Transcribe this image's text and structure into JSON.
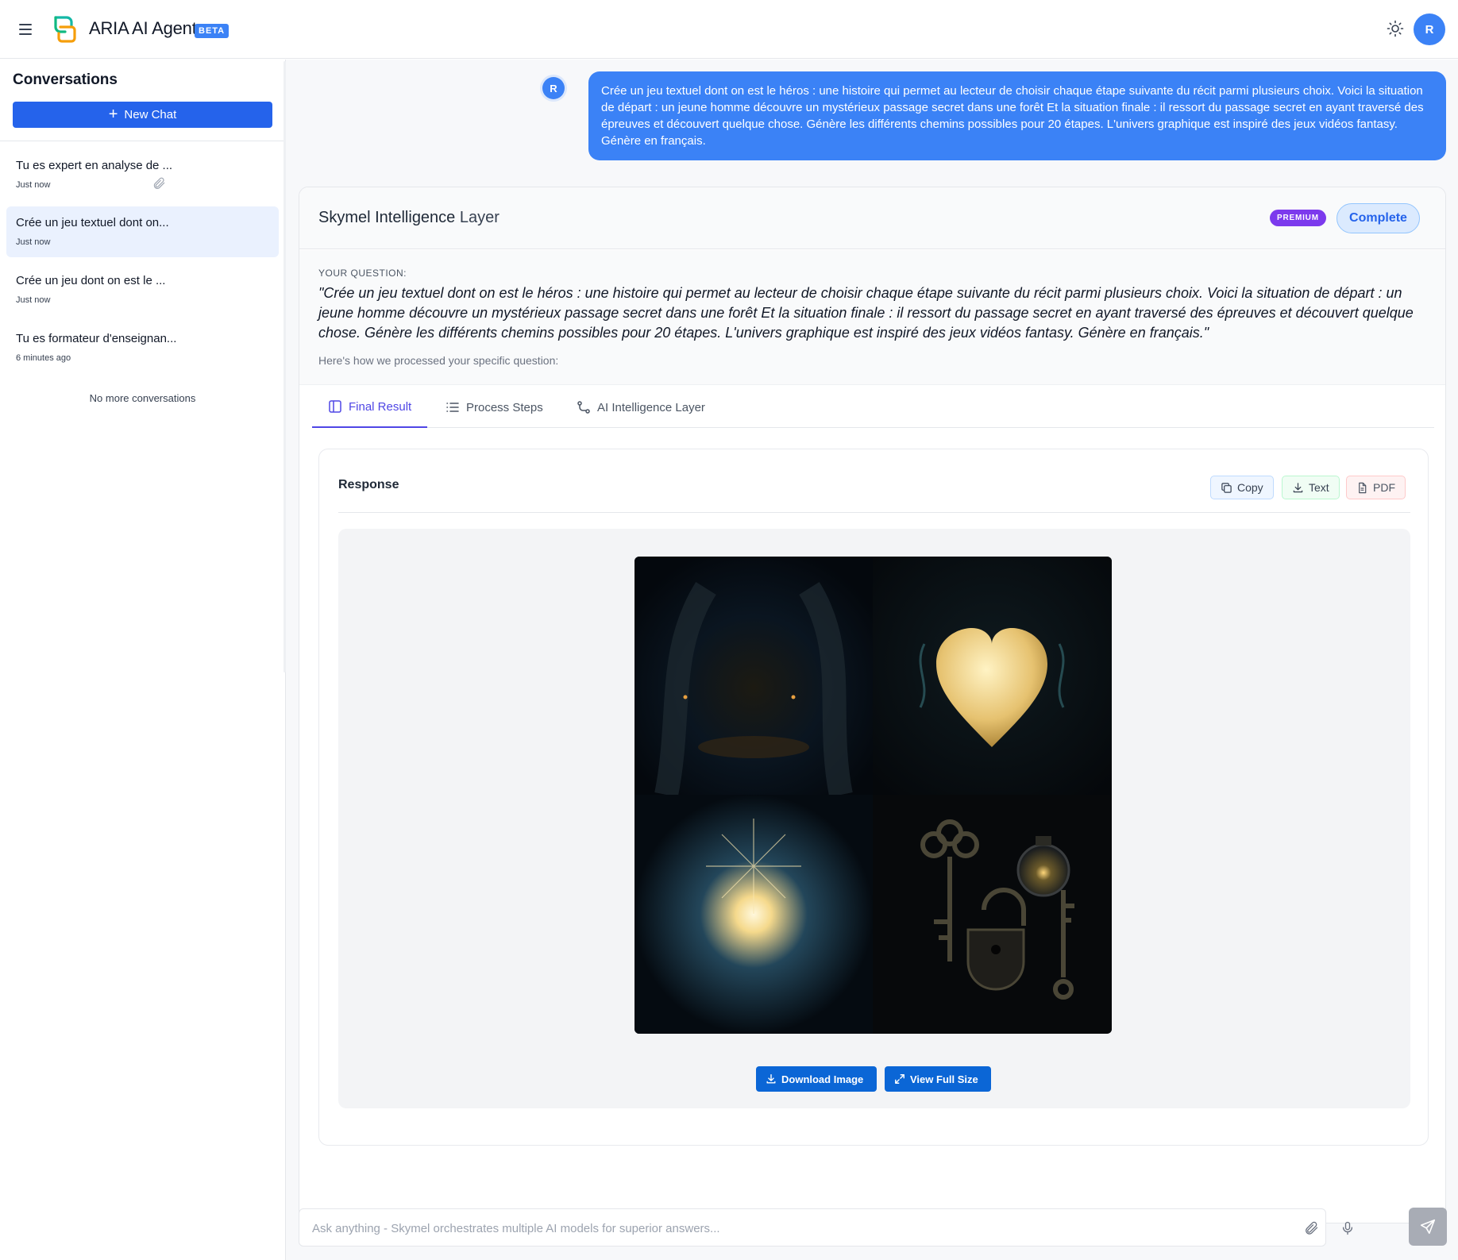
{
  "header": {
    "app_title": "ARIA AI Agent",
    "beta_badge": "BETA",
    "avatar_initial": "R",
    "icons": [
      "hamburger-icon",
      "logo-icon",
      "sun-icon"
    ]
  },
  "sidebar": {
    "title": "Conversations",
    "new_chat_label": "New Chat",
    "conversations": [
      {
        "title": "Tu es expert en analyse de ...",
        "time": "Just now",
        "has_attachment": true
      },
      {
        "title": "Crée un jeu textuel dont on...",
        "time": "Just now",
        "active": true
      },
      {
        "title": "Crée un jeu dont on est le ...",
        "time": "Just now"
      },
      {
        "title": "Tu es formateur d'enseignan...",
        "time": "6 minutes ago"
      }
    ],
    "no_more": "No more conversations"
  },
  "chat": {
    "user_avatar": "R",
    "user_message": "Crée un jeu textuel dont on est le héros : une histoire qui permet au lecteur de choisir chaque étape suivante du récit parmi plusieurs choix. Voici la situation de départ : un jeune homme découvre un mystérieux passage secret dans une forêt Et la situation finale : il ressort du passage secret en ayant traversé des épreuves et découvert quelque chose. Génère les différents chemins possibles pour 20 étapes. L'univers graphique est inspiré des jeux vidéos fantasy. Génère en français."
  },
  "result": {
    "title_bold": "Skymel Intelligence",
    "title_rest": " Layer",
    "premium_badge": "PREMIUM",
    "status": "Complete",
    "question_label": "YOUR QUESTION:",
    "question_text": "\"Crée un jeu textuel dont on est le héros : une histoire qui permet au lecteur de choisir chaque étape suivante du récit parmi plusieurs choix. Voici la situation de départ : un jeune homme découvre un mystérieux passage secret dans une forêt Et la situation finale : il ressort du passage secret en ayant traversé des épreuves et découvert quelque chose. Génère les différents chemins possibles pour 20 étapes. L'univers graphique est inspiré des jeux vidéos fantasy. Génère en français.\"",
    "hint": "Here's how we processed your specific question:",
    "tabs": [
      {
        "label": "Final Result",
        "icon": "panel-icon",
        "active": true
      },
      {
        "label": "Process Steps",
        "icon": "list-icon"
      },
      {
        "label": "AI Intelligence Layer",
        "icon": "route-icon"
      }
    ],
    "response": {
      "title": "Response",
      "copy_label": "Copy",
      "text_label": "Text",
      "pdf_label": "PDF",
      "download_label": "Download Image",
      "fullsize_label": "View Full Size"
    }
  },
  "input": {
    "placeholder": "Ask anything - Skymel orchestrates multiple AI models for superior answers...",
    "value": ""
  },
  "colors": {
    "accent": "#3b82f6",
    "primary_button": "#2563eb",
    "premium": "#7c3aed",
    "active_tab": "#4f46e5"
  }
}
